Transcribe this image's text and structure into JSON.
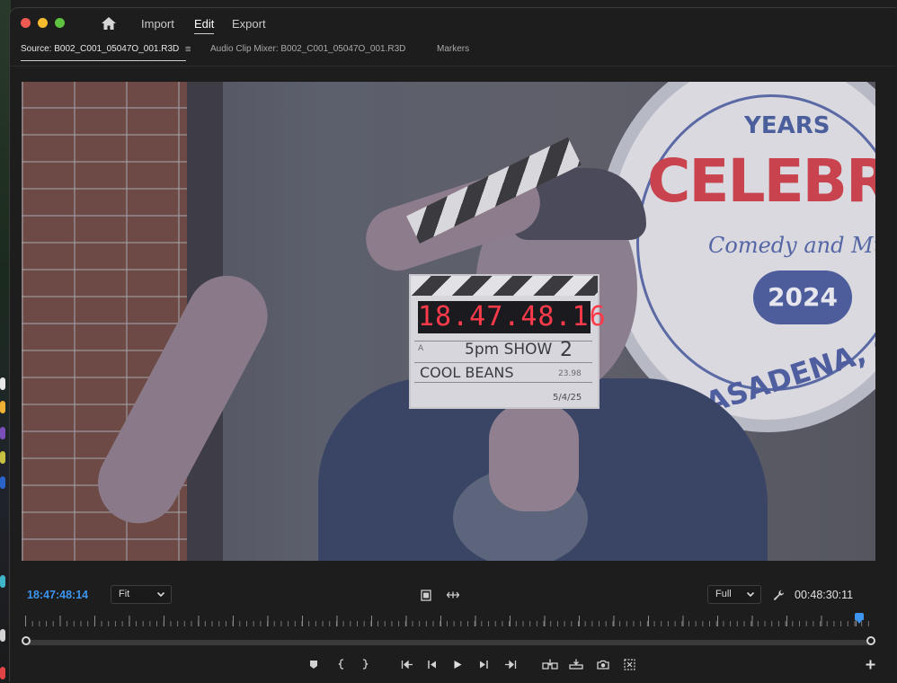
{
  "menu": {
    "import": "Import",
    "edit": "Edit",
    "export": "Export"
  },
  "tabs": {
    "source": "Source: B002_C001_05047O_001.R3D",
    "menu_glyph": "≡",
    "audio_mixer": "Audio Clip Mixer: B002_C001_05047O_001.R3D",
    "markers": "Markers"
  },
  "frame": {
    "slate_timecode": "18.47.48.16",
    "slate_scene": "5pm SHOW",
    "slate_take": "2",
    "slate_title": "COOL BEANS",
    "slate_fps": "23.98",
    "slate_roll": "A",
    "slate_date": "5/4/25",
    "sign_years": "YEARS",
    "sign_title": "CELEBRAT",
    "sign_sub": "Comedy and Music",
    "sign_year": "2024",
    "sign_city": "PASADENA, CALIFO"
  },
  "controls": {
    "timecode_current": "18:47:48:14",
    "zoom_value": "Fit",
    "resolution_value": "Full",
    "timecode_duration": "00:48:30:11",
    "playhead_fraction": 0.987
  },
  "colors": {
    "accent": "#3d95f0",
    "panel": "#1d1d1d",
    "slate_led": "#ff3b4b"
  }
}
